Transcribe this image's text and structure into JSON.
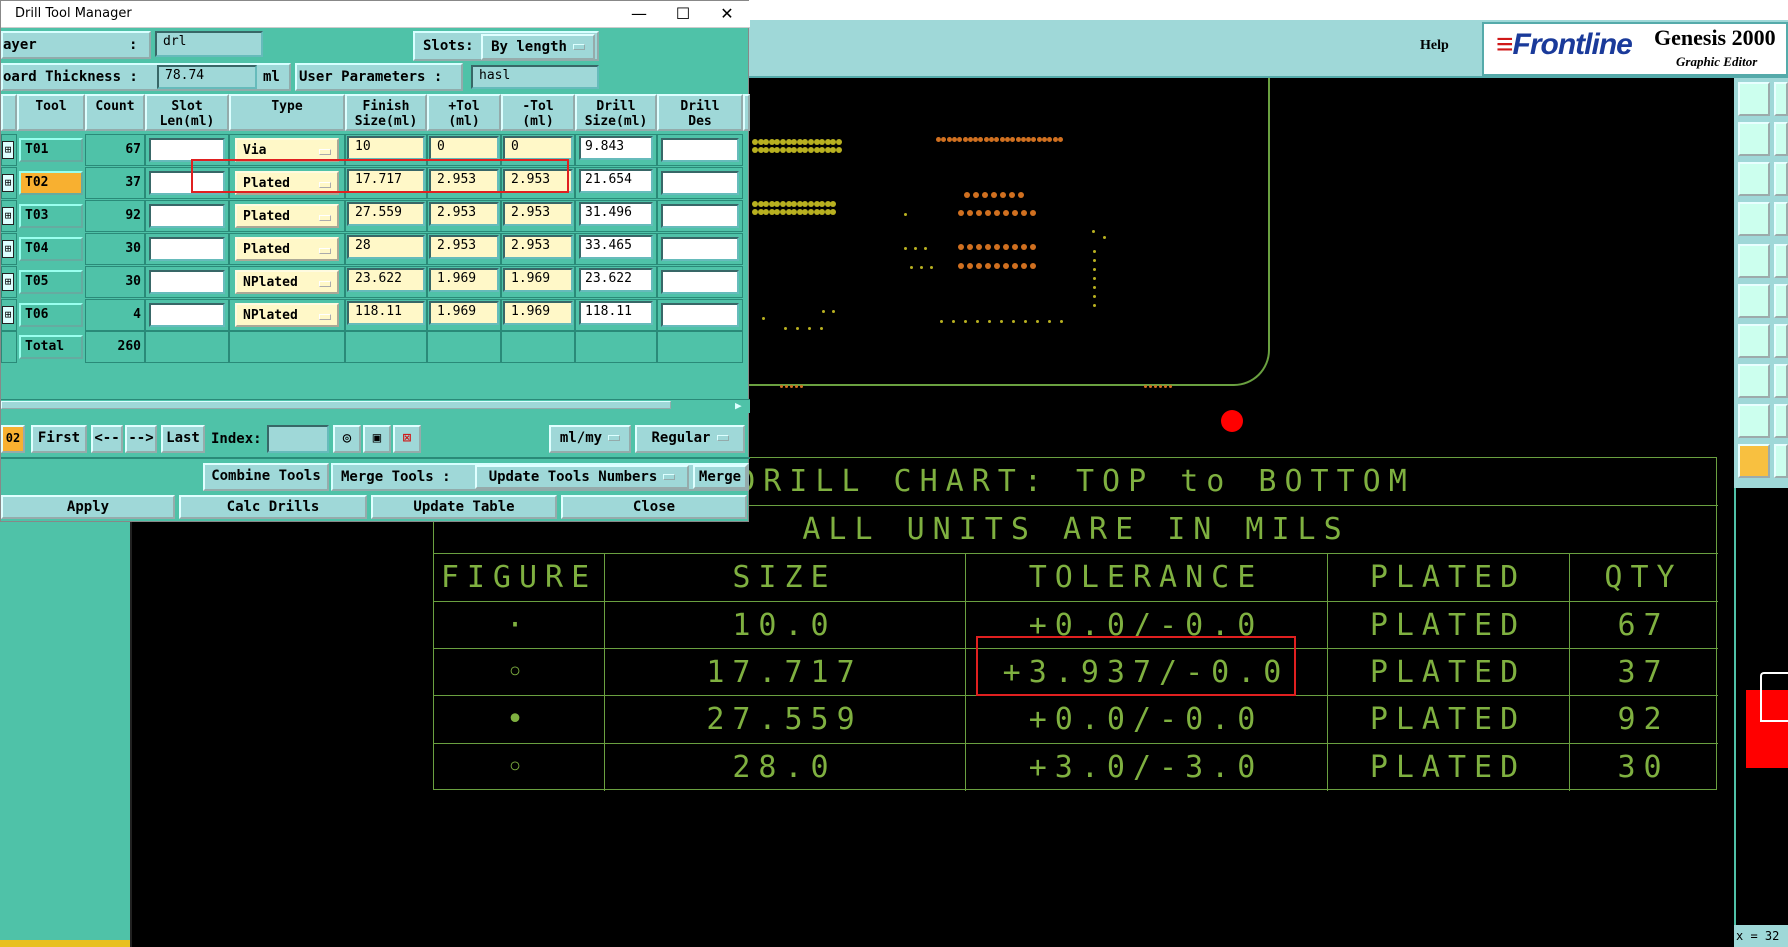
{
  "genesis": {
    "help": "Help",
    "logo": "Frontline",
    "title": "Genesis 2000",
    "subtitle": "Graphic Editor",
    "coord": "x = 32"
  },
  "dialog": {
    "title": "Drill Tool Manager",
    "layer_label": "ayer",
    "layer_colon": ":",
    "layer_value": "drl",
    "slots_label": "Slots:",
    "slots_value": "By length",
    "board_thickness_label": "oard Thickness :",
    "board_thickness_value": "78.74",
    "board_thickness_unit": "ml",
    "user_params_label": "User Parameters :",
    "user_params_value": "hasl",
    "columns": [
      "Tool",
      "Count",
      "Slot\nLen(ml)",
      "Type",
      "Finish\nSize(ml)",
      "+Tol\n(ml)",
      "-Tol\n(ml)",
      "Drill\nSize(ml)",
      "Drill\nDes"
    ],
    "rows": [
      {
        "tool": "T01",
        "count": "67",
        "type": "Via",
        "finish": "10",
        "ptol": "0",
        "mtol": "0",
        "drill": "9.843"
      },
      {
        "tool": "T02",
        "count": "37",
        "type": "Plated",
        "finish": "17.717",
        "ptol": "2.953",
        "mtol": "2.953",
        "drill": "21.654"
      },
      {
        "tool": "T03",
        "count": "92",
        "type": "Plated",
        "finish": "27.559",
        "ptol": "2.953",
        "mtol": "2.953",
        "drill": "31.496"
      },
      {
        "tool": "T04",
        "count": "30",
        "type": "Plated",
        "finish": "28",
        "ptol": "2.953",
        "mtol": "2.953",
        "drill": "33.465"
      },
      {
        "tool": "T05",
        "count": "30",
        "type": "NPlated",
        "finish": "23.622",
        "ptol": "1.969",
        "mtol": "1.969",
        "drill": "23.622"
      },
      {
        "tool": "T06",
        "count": "4",
        "type": "NPlated",
        "finish": "118.11",
        "ptol": "1.969",
        "mtol": "1.969",
        "drill": "118.11"
      }
    ],
    "total_label": "Total",
    "total_value": "260",
    "nav": {
      "current": "02",
      "first": "First",
      "prev": "<--",
      "next": "-->",
      "last": "Last",
      "index_label": "Index:",
      "units": "ml/my",
      "mode": "Regular"
    },
    "combine_tools": "Combine Tools",
    "merge_tools_label": "Merge Tools :",
    "merge_mode": "Update Tools Numbers",
    "merge": "Merge",
    "apply": "Apply",
    "calc_drills": "Calc Drills",
    "update_table": "Update Table",
    "close": "Close"
  },
  "drill_chart": {
    "title": "DRILL CHART: TOP to BOTTOM",
    "units": "ALL UNITS ARE IN MILS",
    "headers": [
      "FIGURE",
      "SIZE",
      "TOLERANCE",
      "PLATED",
      "QTY"
    ],
    "rows": [
      {
        "figure": "·",
        "size": "10.0",
        "tolerance": "+0.0/-0.0",
        "plated": "PLATED",
        "qty": "67"
      },
      {
        "figure": "◦",
        "size": "17.717",
        "tolerance": "+3.937/-0.0",
        "plated": "PLATED",
        "qty": "37"
      },
      {
        "figure": "•",
        "size": "27.559",
        "tolerance": "+0.0/-0.0",
        "plated": "PLATED",
        "qty": "92"
      },
      {
        "figure": "◦",
        "size": "28.0",
        "tolerance": "+3.0/-3.0",
        "plated": "PLATED",
        "qty": "30"
      }
    ]
  },
  "colors": {
    "dialog_bg": "#4fc2a8",
    "header_bg": "#9fd8d8",
    "chart_line": "#6aa040",
    "highlight": "#e02020",
    "selected_tool": "#f8b030"
  }
}
